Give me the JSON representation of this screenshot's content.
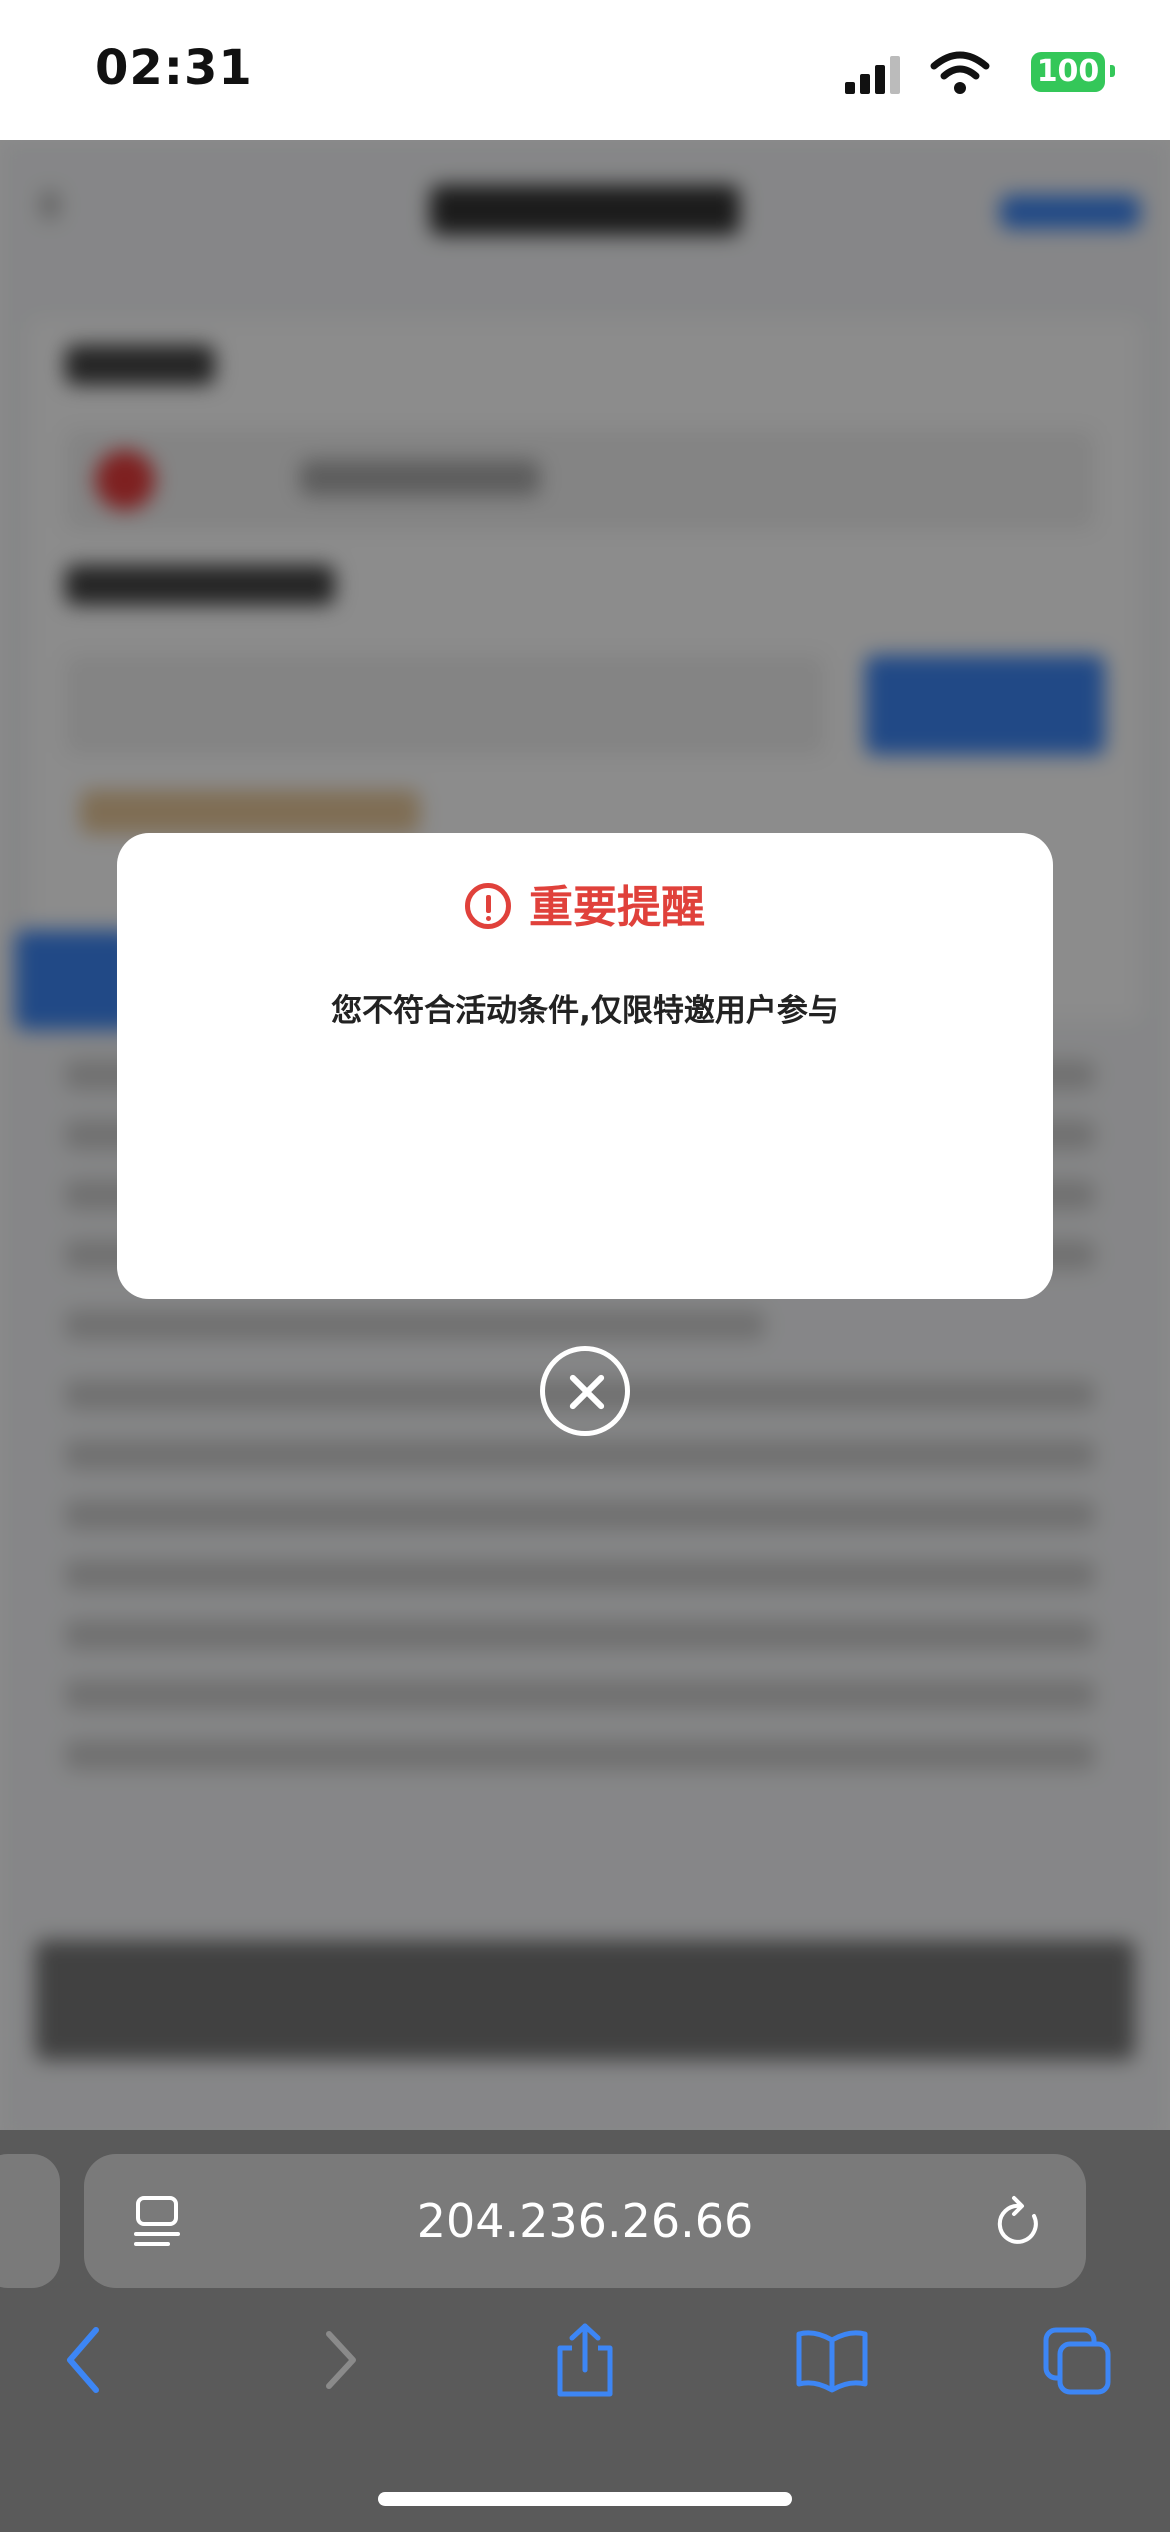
{
  "status_bar": {
    "time": "02:31",
    "battery": "100",
    "battery_color": "#34c759"
  },
  "dialog": {
    "title": "重要提醒",
    "title_icon": "exclamation-circle-icon",
    "message": "您不符合活动条件,仅限特邀用户参与",
    "accent_color": "#e0413b",
    "close_icon": "close-circle-icon"
  },
  "browser": {
    "url": "204.236.26.66",
    "icons": [
      "page-menu-icon",
      "reload-icon",
      "back-icon",
      "forward-icon",
      "share-icon",
      "bookmarks-icon",
      "tabs-icon"
    ],
    "accent_color": "#3d86f5"
  }
}
